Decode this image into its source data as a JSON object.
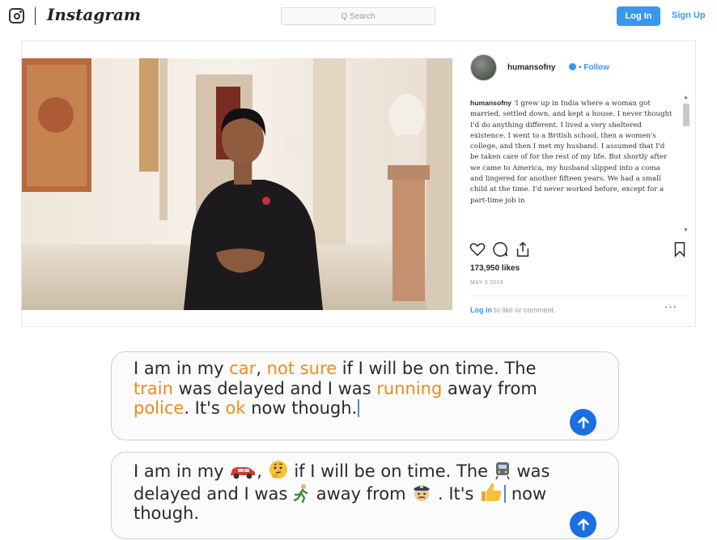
{
  "header": {
    "brand": "Instagram",
    "search_placeholder": "Q Search",
    "login_label": "Log In",
    "signup_label": "Sign Up",
    "icons": {
      "logo": "instagram-camera-icon"
    }
  },
  "post": {
    "username": "humansofny",
    "follow_label": "• Follow",
    "caption_user": "humansofny",
    "caption_text": "'I grew up in India where a woman got married, settled down, and kept a house. I never thought I'd do anything different. I lived a very sheltered existence. I went to a British school, then a women's college, and then I met my husband. I assumed that I'd be taken care of for the rest of my life. But shortly after we came to America, my husband slipped into a coma and lingered for another fifteen years. We had a small child at the time. I'd never worked before, except for a part-time job in",
    "likes": "173,950 likes",
    "date": "MAY 3 2019",
    "comment_login": "Log in",
    "comment_rest": " to like or comment.",
    "more_label": "···",
    "icons": [
      "heart-icon",
      "comment-icon",
      "share-icon",
      "bookmark-icon"
    ]
  },
  "messages": {
    "text_message": {
      "parts": [
        {
          "t": "I am in my ",
          "h": false
        },
        {
          "t": "car",
          "h": true
        },
        {
          "t": ", ",
          "h": false
        },
        {
          "t": "not sure",
          "h": true
        },
        {
          "t": " if I will be on time. The ",
          "h": false
        },
        {
          "t": "train",
          "h": true
        },
        {
          "t": " was delayed and I was ",
          "h": false
        },
        {
          "t": "running",
          "h": true
        },
        {
          "t": " away from ",
          "h": false
        },
        {
          "t": "police",
          "h": true
        },
        {
          "t": ". It's ",
          "h": false
        },
        {
          "t": "ok",
          "h": true
        },
        {
          "t": " now though.",
          "h": false
        }
      ]
    },
    "emoji_message": {
      "segments": [
        "I am in my",
        ",",
        "if I will be on time. The",
        "was delayed and I was",
        "away from",
        ". It's",
        "now though."
      ],
      "emojis": [
        "car-emoji",
        "thinking-face-emoji",
        "train-emoji",
        "running-person-emoji",
        "police-officer-emoji",
        "thumbs-up-emoji"
      ]
    }
  },
  "colors": {
    "highlight": "#f08a1c",
    "send_button": "#1b6fe0",
    "instagram_blue": "#3897f0"
  }
}
